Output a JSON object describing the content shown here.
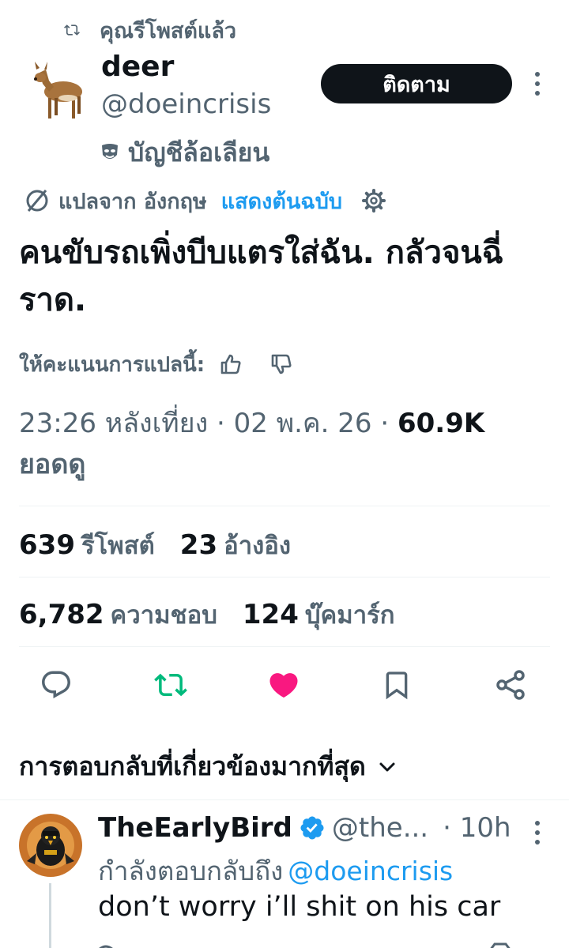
{
  "repost": {
    "icon": "repost-icon",
    "label": "คุณรีโพสต์แล้ว"
  },
  "author": {
    "display_name": "deer",
    "handle": "@doeincrisis",
    "parody_label": "บัญชีล้อเลียน",
    "follow_label": "ติดตาม"
  },
  "translation": {
    "label": "แปลจาก อังกฤษ",
    "show_original": "แสดงต้นฉบับ"
  },
  "tweet": {
    "text": "คนขับรถเพิ่งบีบแตรใส่ฉัน. กลัวจนฉี่ราด.",
    "rate_label": "ให้คะแนนการแปลนี้:",
    "meta": "23:26 หลังเที่ยง · 02 พ.ค. 26 · ",
    "views_count": "60.9K",
    "views_label": "ยอดดู"
  },
  "stats": {
    "reposts_count": "639",
    "reposts_label": "รีโพสต์",
    "quotes_count": "23",
    "quotes_label": "อ้างอิง",
    "likes_count": "6,782",
    "likes_label": "ความชอบ",
    "bookmarks_count": "124",
    "bookmarks_label": "บุ๊คมาร์ก"
  },
  "actions": [
    "reply-icon",
    "repost-icon",
    "like-icon",
    "bookmark-icon",
    "share-icon"
  ],
  "replies_header": {
    "label": "การตอบกลับที่เกี่ยวข้องมากที่สุด"
  },
  "reply": {
    "display_name": "TheEarlyBird",
    "handle": "@the...",
    "time": "· 10h",
    "replying_label": "กำลังตอบกลับถึง",
    "replying_handle": "@doeincrisis",
    "text": "don’t worry i’ll shit on his car"
  },
  "colors": {
    "text": "#0f1419",
    "secondary": "#536471",
    "accent_blue": "#1d9bf0",
    "repost_green": "#00ba7c",
    "like_pink": "#f91880",
    "divider": "#eff3f4"
  }
}
